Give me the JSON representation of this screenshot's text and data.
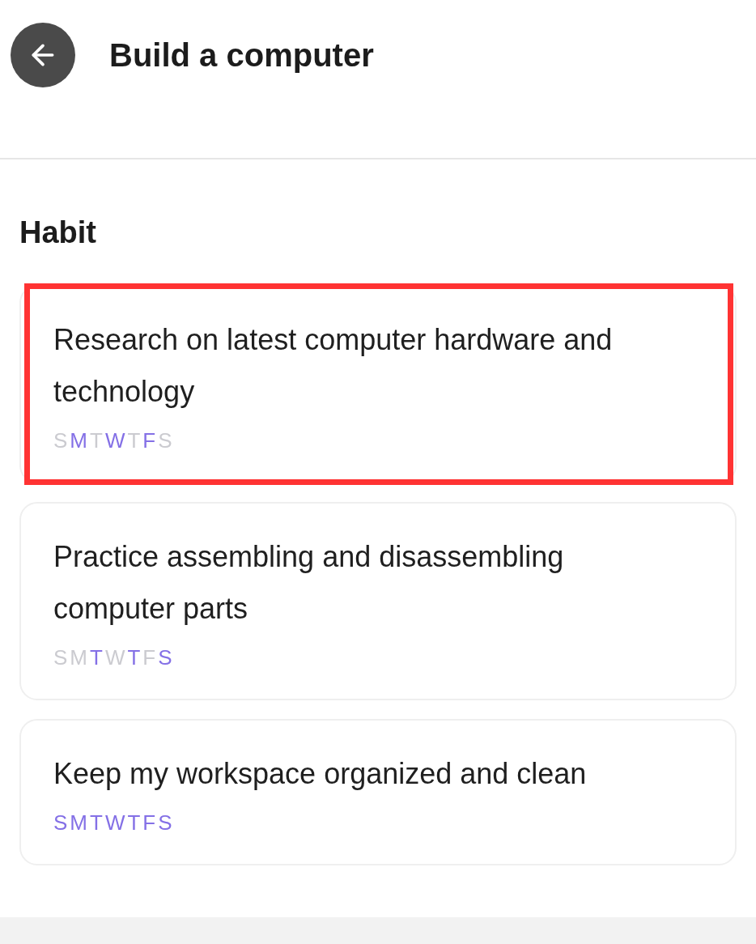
{
  "header": {
    "title": "Build a computer"
  },
  "section": {
    "title": "Habit"
  },
  "habits": [
    {
      "title": "Research on latest computer hardware and technology",
      "highlighted": true,
      "days": [
        {
          "label": "S",
          "active": false
        },
        {
          "label": "M",
          "active": true
        },
        {
          "label": "T",
          "active": false
        },
        {
          "label": "W",
          "active": true
        },
        {
          "label": "T",
          "active": false
        },
        {
          "label": "F",
          "active": true
        },
        {
          "label": "S",
          "active": false
        }
      ]
    },
    {
      "title": "Practice assembling and disassembling computer parts",
      "highlighted": false,
      "days": [
        {
          "label": "S",
          "active": false
        },
        {
          "label": "M",
          "active": false
        },
        {
          "label": "T",
          "active": true
        },
        {
          "label": "W",
          "active": false
        },
        {
          "label": "T",
          "active": true
        },
        {
          "label": "F",
          "active": false
        },
        {
          "label": "S",
          "active": true
        }
      ]
    },
    {
      "title": "Keep my workspace organized and clean",
      "highlighted": false,
      "days": [
        {
          "label": "S",
          "active": true
        },
        {
          "label": "M",
          "active": true
        },
        {
          "label": "T",
          "active": true
        },
        {
          "label": "W",
          "active": true
        },
        {
          "label": "T",
          "active": true
        },
        {
          "label": "F",
          "active": true
        },
        {
          "label": "S",
          "active": true
        }
      ]
    }
  ]
}
